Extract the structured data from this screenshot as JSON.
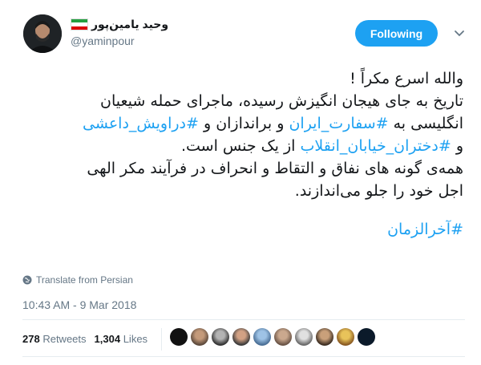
{
  "user": {
    "display_name": "وحید یامین‌پور",
    "handle": "@yaminpour"
  },
  "follow_button": {
    "label": "Following"
  },
  "tweet": {
    "lines": [
      "والله اسرع مکراً !",
      "تاریخ به جای هیجان انگیزش رسیده، ماجرای حمله شیعیان",
      "انگلیسی به",
      "سفارت_ایران",
      "و براندازان و",
      "دراویش_داعشی",
      "و",
      "دختران_خیابان_انقلاب",
      "از یک جنس است.",
      "همه‌ی گونه های نفاق و التقاط و انحراف در فرآیند مکر الهی",
      "اجل خود را جلو می‌اندازند."
    ],
    "hashtag_final": "#آخرالزمان",
    "hashtag_prefix": "#"
  },
  "translate_label": "Translate from Persian",
  "timestamp": "10:43 AM - 9 Mar 2018",
  "stats": {
    "retweets_count": "278",
    "retweets_label": "Retweets",
    "likes_count": "1,304",
    "likes_label": "Likes"
  },
  "colors": {
    "accent": "#1da1f2",
    "muted": "#657786",
    "divider": "#e6ecf0",
    "flag_green": "#239f40",
    "flag_red": "#da0000"
  },
  "icons": {
    "flag": "iran-flag-icon",
    "caret": "chevron-down-icon",
    "globe": "globe-icon"
  }
}
